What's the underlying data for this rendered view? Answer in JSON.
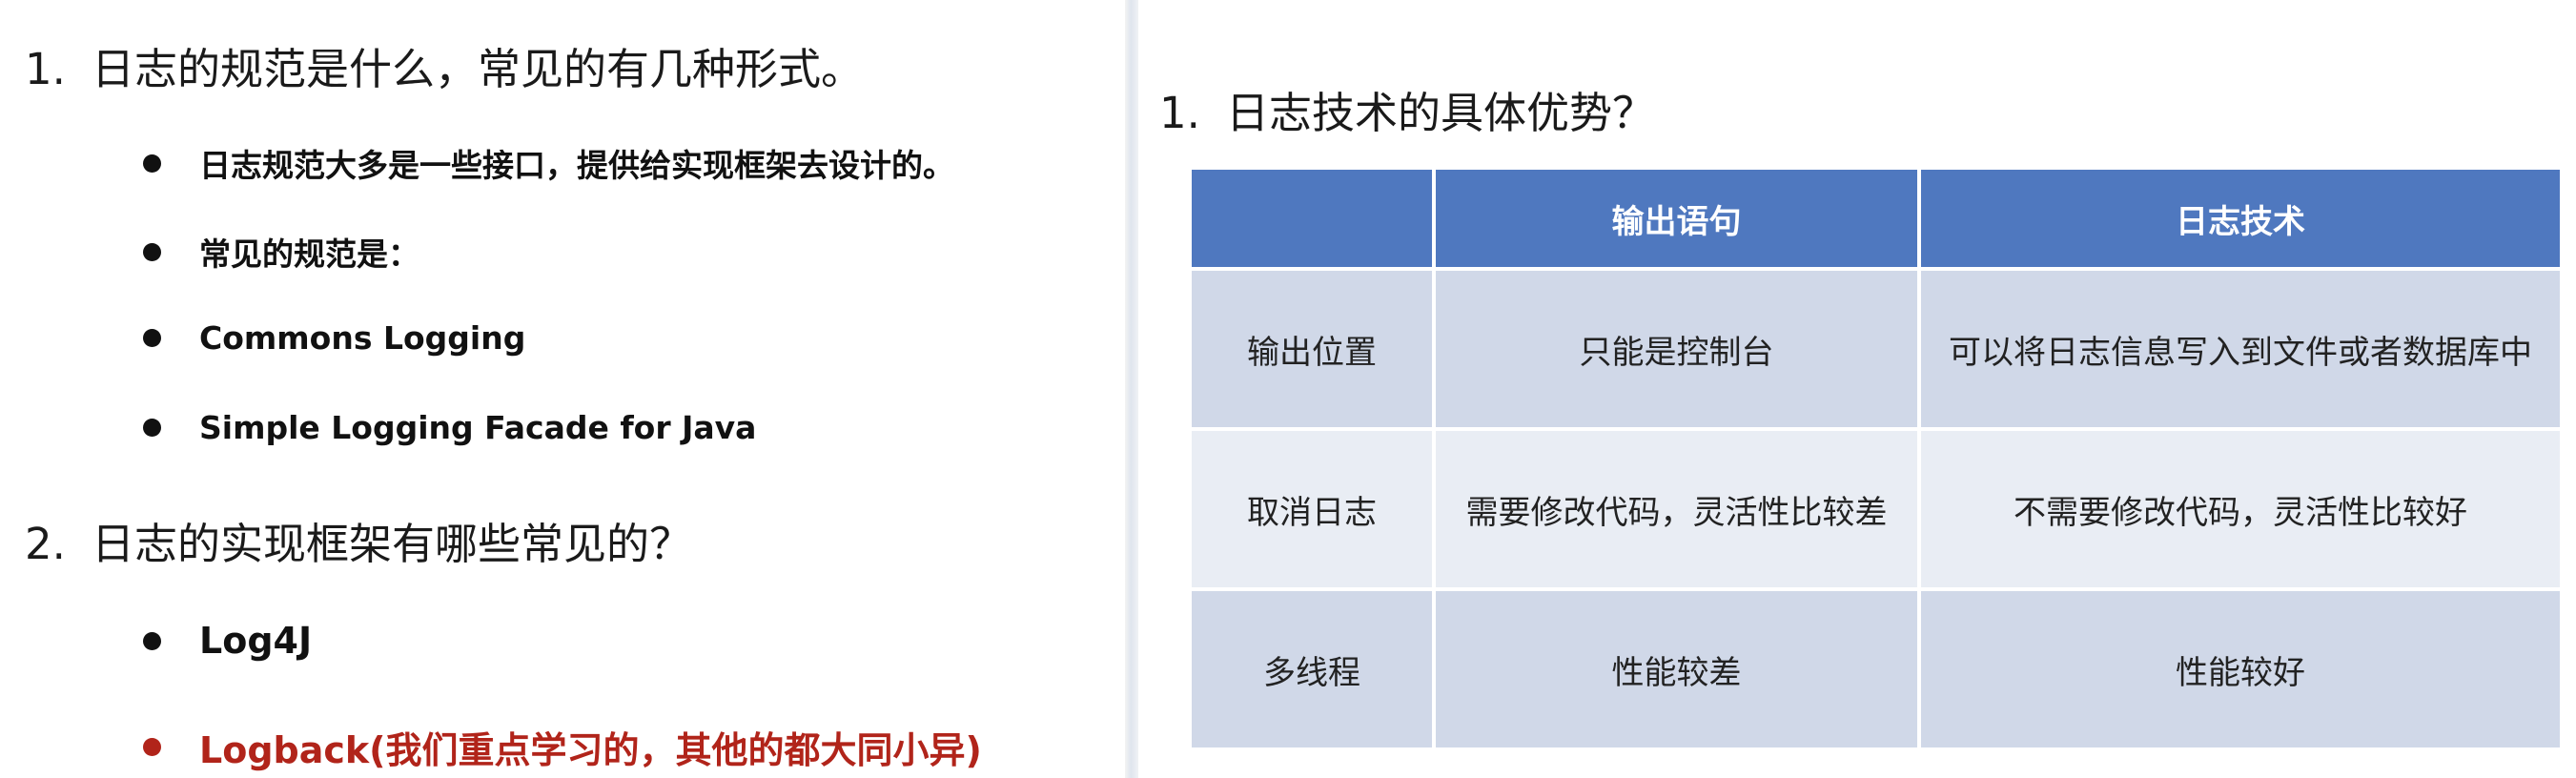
{
  "left": {
    "q1": {
      "number": "1.",
      "text": "日志的规范是什么，常见的有几种形式。",
      "bullets": [
        "日志规范大多是一些接口，提供给实现框架去设计的。",
        "常见的规范是：",
        "Commons Logging",
        "Simple Logging Facade for Java"
      ]
    },
    "q2": {
      "number": "2.",
      "text": "日志的实现框架有哪些常见的？",
      "bullets": [
        "Log4J",
        "Logback(我们重点学习的，其他的都大同小异)"
      ]
    }
  },
  "right": {
    "q1": {
      "number": "1.",
      "text": "日志技术的具体优势？"
    },
    "table": {
      "headers": [
        "",
        "输出语句",
        "日志技术"
      ],
      "rows": [
        [
          "输出位置",
          "只能是控制台",
          "可以将日志信息写入到文件或者数据库中"
        ],
        [
          "取消日志",
          "需要修改代码，灵活性比较差",
          "不需要修改代码，灵活性比较好"
        ],
        [
          "多线程",
          "性能较差",
          "性能较好"
        ]
      ]
    }
  },
  "colors": {
    "header_blue": "#4f78bf",
    "row_dark": "#d0d8e8",
    "row_light": "#e9edf4",
    "highlight_red": "#b1241a"
  }
}
